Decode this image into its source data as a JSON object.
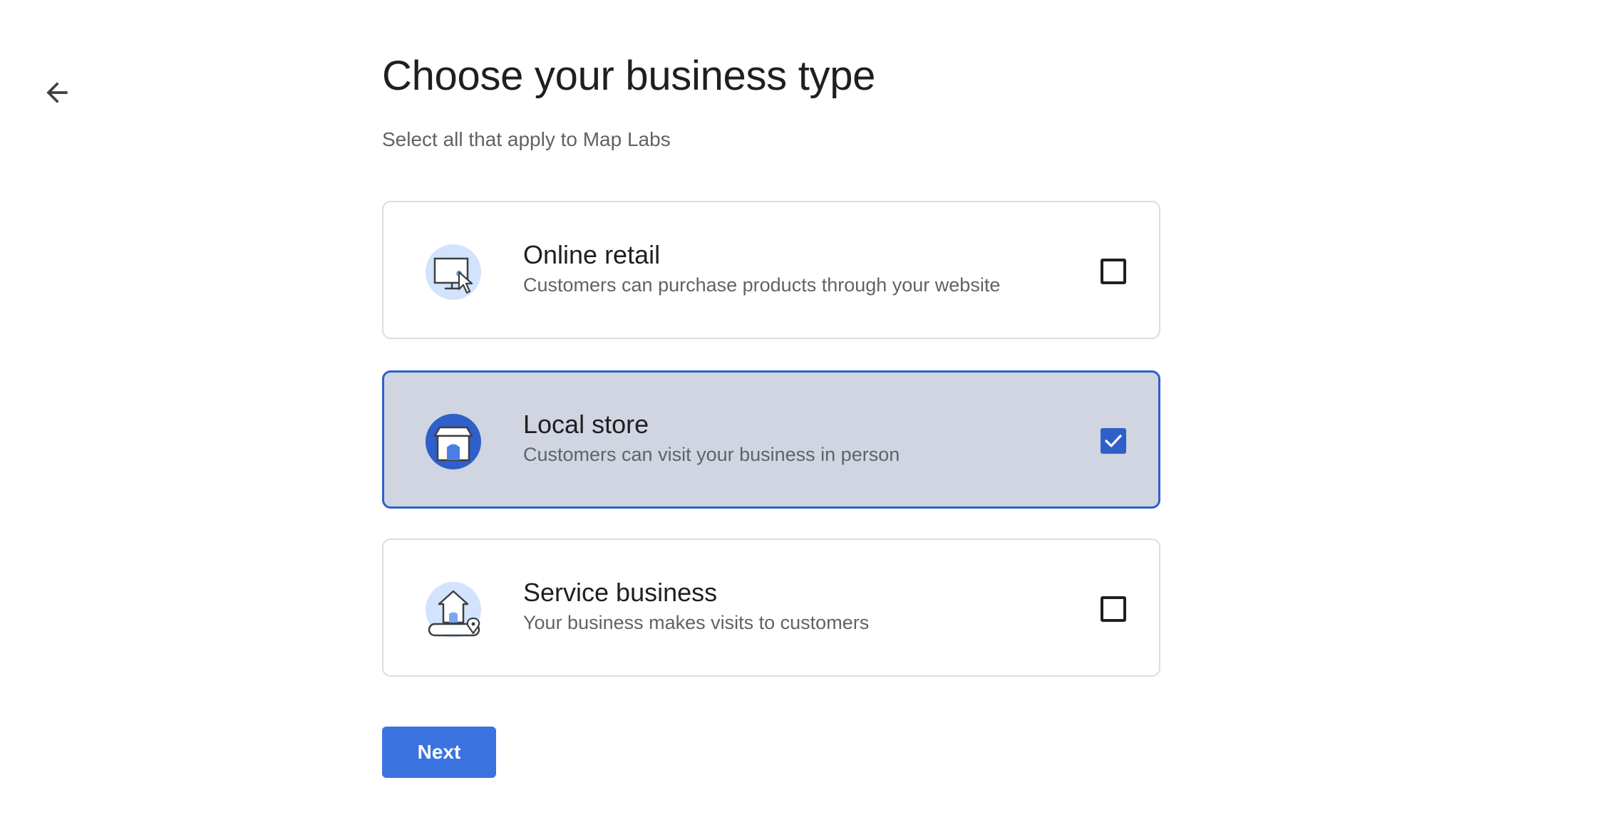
{
  "header": {
    "back_icon": "arrow-left-icon",
    "title": "Choose your business type",
    "subtitle": "Select all that apply to Map Labs"
  },
  "options": [
    {
      "title": "Online retail",
      "description": "Customers can purchase products through your website",
      "icon": "monitor-cursor-icon",
      "checked": false
    },
    {
      "title": "Local store",
      "description": "Customers can visit your business in person",
      "icon": "storefront-icon",
      "checked": true
    },
    {
      "title": "Service business",
      "description": "Your business makes visits to customers",
      "icon": "house-location-icon",
      "checked": false
    }
  ],
  "actions": {
    "next_label": "Next"
  },
  "colors": {
    "accent": "#3a73e0",
    "selected_border": "#2f5fc8",
    "selected_background": "#d0d5e1",
    "icon_circle_light": "#d3e3fd",
    "icon_circle_dark": "#2f5fc8"
  }
}
